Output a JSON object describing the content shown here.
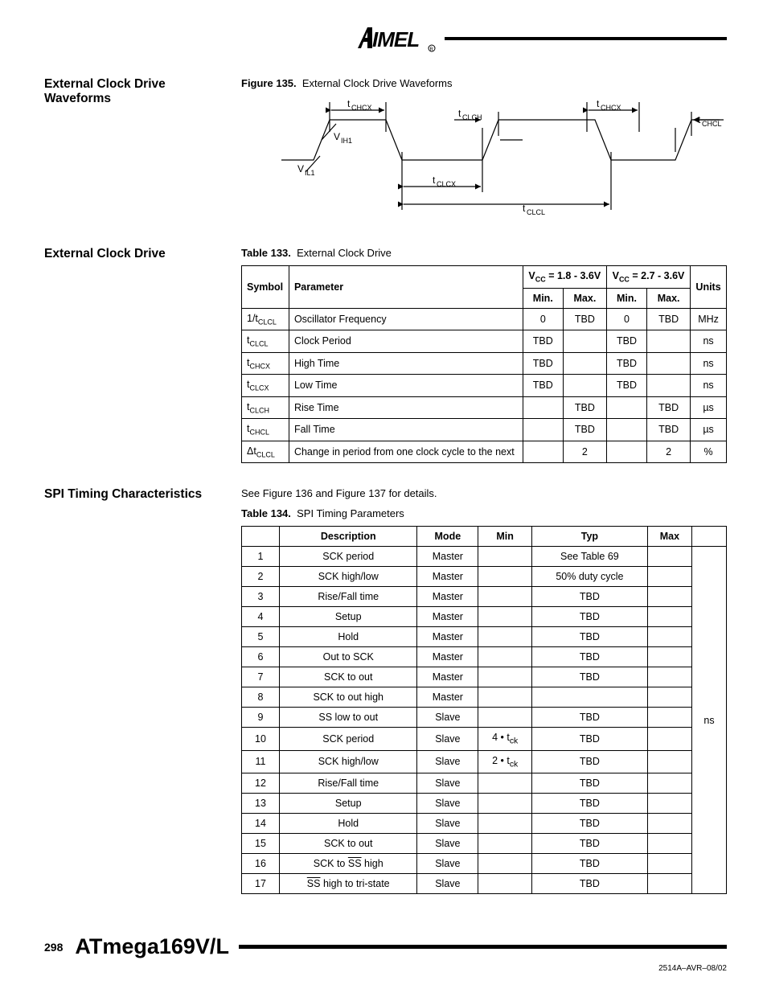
{
  "logo_text": "AIMEL",
  "sections": {
    "s1_heading": "External Clock Drive Waveforms",
    "fig_caption_b": "Figure 135.",
    "fig_caption": "External Clock Drive Waveforms",
    "s2_heading": "External Clock Drive",
    "tbl133_caption_b": "Table 133.",
    "tbl133_caption": "External Clock Drive",
    "s3_heading": "SPI Timing Characteristics",
    "s3_intro": "See Figure 136 and Figure 137 for details.",
    "tbl134_caption_b": "Table 134.",
    "tbl134_caption": "SPI Timing Parameters"
  },
  "waveform_labels": {
    "tchcx": "CHCX",
    "tclch": "CLCH",
    "tchcl": "CHCL",
    "vih1": "IH1",
    "vil1": "IL1",
    "tclcx": "CLCX",
    "tclcl": "CLCL"
  },
  "table133": {
    "head": {
      "vcc1": "V",
      "vcc1_rest": " = 1.8 - 3.6V",
      "vcc2": "V",
      "vcc2_rest": " = 2.7 - 3.6V",
      "symbol": "Symbol",
      "parameter": "Parameter",
      "min": "Min.",
      "max": "Max.",
      "units": "Units"
    },
    "rows": [
      {
        "sym_pre": "1/t",
        "sym_sub": "CLCL",
        "param": "Oscillator Frequency",
        "min1": "0",
        "max1": "TBD",
        "min2": "0",
        "max2": "TBD",
        "units": "MHz"
      },
      {
        "sym_pre": "t",
        "sym_sub": "CLCL",
        "param": "Clock Period",
        "min1": "TBD",
        "max1": "",
        "min2": "TBD",
        "max2": "",
        "units": "ns"
      },
      {
        "sym_pre": "t",
        "sym_sub": "CHCX",
        "param": "High Time",
        "min1": "TBD",
        "max1": "",
        "min2": "TBD",
        "max2": "",
        "units": "ns"
      },
      {
        "sym_pre": "t",
        "sym_sub": "CLCX",
        "param": "Low Time",
        "min1": "TBD",
        "max1": "",
        "min2": "TBD",
        "max2": "",
        "units": "ns"
      },
      {
        "sym_pre": "t",
        "sym_sub": "CLCH",
        "param": "Rise Time",
        "min1": "",
        "max1": "TBD",
        "min2": "",
        "max2": "TBD",
        "units": "µs"
      },
      {
        "sym_pre": "t",
        "sym_sub": "CHCL",
        "param": "Fall Time",
        "min1": "",
        "max1": "TBD",
        "min2": "",
        "max2": "TBD",
        "units": "µs"
      },
      {
        "sym_pre": "Δt",
        "sym_sub": "CLCL",
        "param": "Change in period from one clock cycle to the next",
        "min1": "",
        "max1": "2",
        "min2": "",
        "max2": "2",
        "units": "%"
      }
    ]
  },
  "table134": {
    "head": {
      "desc": "Description",
      "mode": "Mode",
      "min": "Min",
      "typ": "Typ",
      "max": "Max"
    },
    "unit": "ns",
    "rows": [
      {
        "n": "1",
        "desc": "SCK period",
        "mode": "Master",
        "min": "",
        "typ": "See Table 69",
        "max": ""
      },
      {
        "n": "2",
        "desc": "SCK high/low",
        "mode": "Master",
        "min": "",
        "typ": "50% duty cycle",
        "max": ""
      },
      {
        "n": "3",
        "desc": "Rise/Fall time",
        "mode": "Master",
        "min": "",
        "typ": "TBD",
        "max": ""
      },
      {
        "n": "4",
        "desc": "Setup",
        "mode": "Master",
        "min": "",
        "typ": "TBD",
        "max": ""
      },
      {
        "n": "5",
        "desc": "Hold",
        "mode": "Master",
        "min": "",
        "typ": "TBD",
        "max": ""
      },
      {
        "n": "6",
        "desc": "Out to SCK",
        "mode": "Master",
        "min": "",
        "typ": "TBD",
        "max": ""
      },
      {
        "n": "7",
        "desc": "SCK to out",
        "mode": "Master",
        "min": "",
        "typ": "TBD",
        "max": ""
      },
      {
        "n": "8",
        "desc": "SCK to out high",
        "mode": "Master",
        "min": "",
        "typ": "",
        "max": ""
      },
      {
        "n": "9",
        "desc": "SS low to out",
        "mode": "Slave",
        "min": "",
        "typ": "TBD",
        "max": ""
      },
      {
        "n": "10",
        "desc": "SCK period",
        "mode": "Slave",
        "min_html": "4 • t<sub>ck</sub>",
        "typ": "TBD",
        "max": ""
      },
      {
        "n": "11",
        "desc": "SCK high/low",
        "mode": "Slave",
        "min_html": "2 • t<sub>ck</sub>",
        "typ": "TBD",
        "max": ""
      },
      {
        "n": "12",
        "desc": "Rise/Fall time",
        "mode": "Slave",
        "min": "",
        "typ": "TBD",
        "max": ""
      },
      {
        "n": "13",
        "desc": "Setup",
        "mode": "Slave",
        "min": "",
        "typ": "TBD",
        "max": ""
      },
      {
        "n": "14",
        "desc": "Hold",
        "mode": "Slave",
        "min": "",
        "typ": "TBD",
        "max": ""
      },
      {
        "n": "15",
        "desc": "SCK to out",
        "mode": "Slave",
        "min": "",
        "typ": "TBD",
        "max": ""
      },
      {
        "n": "16",
        "desc_html": "SCK to <span class='supbar'>SS</span> high",
        "mode": "Slave",
        "min": "",
        "typ": "TBD",
        "max": ""
      },
      {
        "n": "17",
        "desc_html": "<span class='supbar'>SS</span> high to tri-state",
        "mode": "Slave",
        "min": "",
        "typ": "TBD",
        "max": ""
      }
    ]
  },
  "footer": {
    "page": "298",
    "title": "ATmega169V/L",
    "id": "2514A–AVR–08/02"
  }
}
